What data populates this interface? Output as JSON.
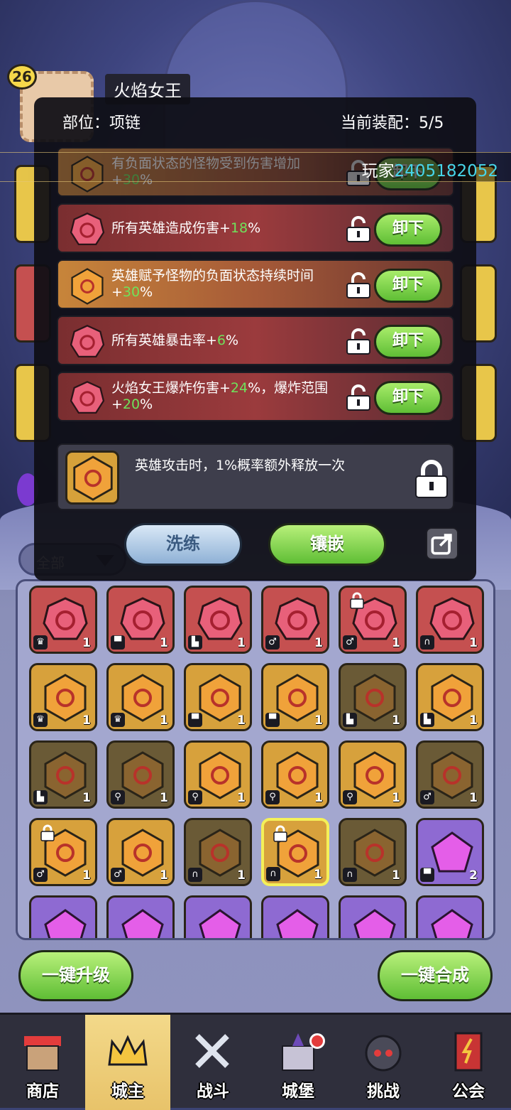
{
  "hero": {
    "level": "26",
    "name": "火焰女王"
  },
  "modal": {
    "position_label": "部位：项链",
    "equip_label": "当前装配：5/5",
    "player_prefix": "玩家",
    "player_id": "2405182052",
    "bars": [
      {
        "text_a": "有负面状态的怪物受到伤害增加+",
        "value": "30",
        "text_b": "%",
        "gem": "gold",
        "button": "卸下"
      },
      {
        "text_a": "所有英雄造成伤害+",
        "value": "18",
        "text_b": "%",
        "gem": "red",
        "button": "卸下"
      },
      {
        "text_a": "英雄赋予怪物的负面状态持续时间+",
        "value": "30",
        "text_b": "%",
        "gem": "gold",
        "button": "卸下"
      },
      {
        "text_a": "所有英雄暴击率+",
        "value": "6",
        "text_b": "%",
        "gem": "red",
        "button": "卸下"
      },
      {
        "text_a": "火焰女王爆炸伤害+",
        "value": "24",
        "text_b": "%，爆炸范围+",
        "value2": "20",
        "text_c": "%",
        "gem": "red",
        "button": "卸下"
      }
    ],
    "locked_text": "英雄攻击时，1%概率额外释放一次",
    "wash_button": "洗练",
    "inlay_button": "镶嵌"
  },
  "filter_label": "全部",
  "grid": [
    {
      "color": "red",
      "tag": "crown",
      "count": "1"
    },
    {
      "color": "red",
      "tag": "shirt",
      "count": "1"
    },
    {
      "color": "red",
      "tag": "boot",
      "count": "1"
    },
    {
      "color": "red",
      "tag": "ring",
      "count": "1"
    },
    {
      "color": "red",
      "tag": "ring",
      "count": "1",
      "locked": true
    },
    {
      "color": "red",
      "tag": "neck",
      "count": "1"
    },
    {
      "color": "gold",
      "tag": "crown",
      "count": "1"
    },
    {
      "color": "gold",
      "tag": "crown",
      "count": "1"
    },
    {
      "color": "gold",
      "tag": "shirt",
      "count": "1"
    },
    {
      "color": "gold",
      "tag": "shirt",
      "count": "1"
    },
    {
      "color": "dark",
      "tag": "boot",
      "count": "1"
    },
    {
      "color": "gold",
      "tag": "boot",
      "count": "1"
    },
    {
      "color": "dark",
      "tag": "boot",
      "count": "1"
    },
    {
      "color": "dark",
      "tag": "axe",
      "count": "1"
    },
    {
      "color": "gold",
      "tag": "axe",
      "count": "1"
    },
    {
      "color": "gold",
      "tag": "axe",
      "count": "1"
    },
    {
      "color": "gold",
      "tag": "axe",
      "count": "1"
    },
    {
      "color": "dark",
      "tag": "ring",
      "count": "1"
    },
    {
      "color": "gold",
      "tag": "ring",
      "count": "1",
      "locked": true
    },
    {
      "color": "gold",
      "tag": "ring",
      "count": "1"
    },
    {
      "color": "dark",
      "tag": "neck",
      "count": "1"
    },
    {
      "color": "gold",
      "tag": "neck",
      "count": "1",
      "locked": true,
      "highlight": true
    },
    {
      "color": "dark",
      "tag": "neck",
      "count": "1"
    },
    {
      "color": "purple",
      "tag": "shirt",
      "count": "2"
    },
    {
      "color": "purple",
      "tag": "",
      "count": ""
    },
    {
      "color": "purple",
      "tag": "",
      "count": ""
    },
    {
      "color": "purple",
      "tag": "",
      "count": ""
    },
    {
      "color": "purple",
      "tag": "",
      "count": ""
    },
    {
      "color": "purple",
      "tag": "",
      "count": ""
    },
    {
      "color": "purple",
      "tag": "",
      "count": ""
    }
  ],
  "actions": {
    "upgrade_all": "一键升级",
    "merge_all": "一键合成"
  },
  "nav": [
    {
      "label": "商店",
      "icon": "shop-icon"
    },
    {
      "label": "城主",
      "icon": "crown-icon",
      "active": true
    },
    {
      "label": "战斗",
      "icon": "swords-icon"
    },
    {
      "label": "城堡",
      "icon": "castle-icon",
      "badge": true
    },
    {
      "label": "挑战",
      "icon": "demon-icon"
    },
    {
      "label": "公会",
      "icon": "banner-icon"
    }
  ],
  "colors": {
    "accent_green": "#6fe25b",
    "player_id": "#47d4e8",
    "gem_red": "#c55050",
    "gem_gold": "#d7a13c",
    "gem_purple": "#8e6ad2"
  }
}
